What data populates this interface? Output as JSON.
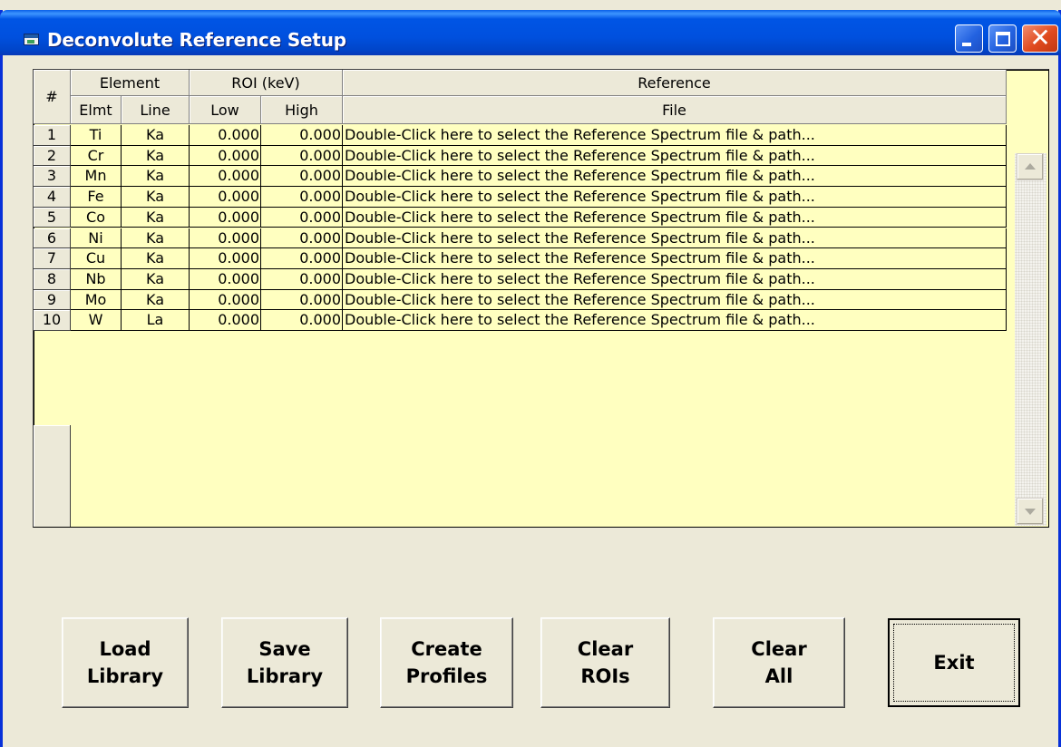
{
  "window": {
    "title": "Deconvolute Reference Setup"
  },
  "grid": {
    "headers": {
      "number": "#",
      "element": "Element",
      "roi": "ROI (keV)",
      "reference": "Reference",
      "elmt": "Elmt",
      "line": "Line",
      "low": "Low",
      "high": "High",
      "file": "File"
    },
    "rows": [
      {
        "num": "1",
        "elmt": "Ti",
        "line": "Ka",
        "low": "0.000",
        "high": "0.000",
        "file": "Double-Click here to select the Reference Spectrum file & path..."
      },
      {
        "num": "2",
        "elmt": "Cr",
        "line": "Ka",
        "low": "0.000",
        "high": "0.000",
        "file": "Double-Click here to select the Reference Spectrum file & path..."
      },
      {
        "num": "3",
        "elmt": "Mn",
        "line": "Ka",
        "low": "0.000",
        "high": "0.000",
        "file": "Double-Click here to select the Reference Spectrum file & path..."
      },
      {
        "num": "4",
        "elmt": "Fe",
        "line": "Ka",
        "low": "0.000",
        "high": "0.000",
        "file": "Double-Click here to select the Reference Spectrum file & path..."
      },
      {
        "num": "5",
        "elmt": "Co",
        "line": "Ka",
        "low": "0.000",
        "high": "0.000",
        "file": "Double-Click here to select the Reference Spectrum file & path..."
      },
      {
        "num": "6",
        "elmt": "Ni",
        "line": "Ka",
        "low": "0.000",
        "high": "0.000",
        "file": "Double-Click here to select the Reference Spectrum file & path..."
      },
      {
        "num": "7",
        "elmt": "Cu",
        "line": "Ka",
        "low": "0.000",
        "high": "0.000",
        "file": "Double-Click here to select the Reference Spectrum file & path..."
      },
      {
        "num": "8",
        "elmt": "Nb",
        "line": "Ka",
        "low": "0.000",
        "high": "0.000",
        "file": "Double-Click here to select the Reference Spectrum file & path..."
      },
      {
        "num": "9",
        "elmt": "Mo",
        "line": "Ka",
        "low": "0.000",
        "high": "0.000",
        "file": "Double-Click here to select the Reference Spectrum file & path..."
      },
      {
        "num": "10",
        "elmt": "W",
        "line": "La",
        "low": "0.000",
        "high": "0.000",
        "file": "Double-Click here to select the Reference Spectrum file & path..."
      }
    ]
  },
  "buttons": {
    "load": "Load\nLibrary",
    "save": "Save\nLibrary",
    "create": "Create\nProfiles",
    "clear_rois": "Clear\nROIs",
    "clear_all": "Clear\nAll",
    "exit": "Exit"
  },
  "icons": {
    "app": "app-window-icon",
    "minimize": "minimize-icon",
    "maximize": "maximize-icon",
    "close": "close-icon",
    "scroll_up": "scroll-up-arrow-icon",
    "scroll_down": "scroll-down-arrow-icon"
  },
  "colors": {
    "title_bar": "#0055e5",
    "grid_background": "#ffffc0",
    "dialog_background": "#ece9d8",
    "close_button": "#e04a1e"
  }
}
